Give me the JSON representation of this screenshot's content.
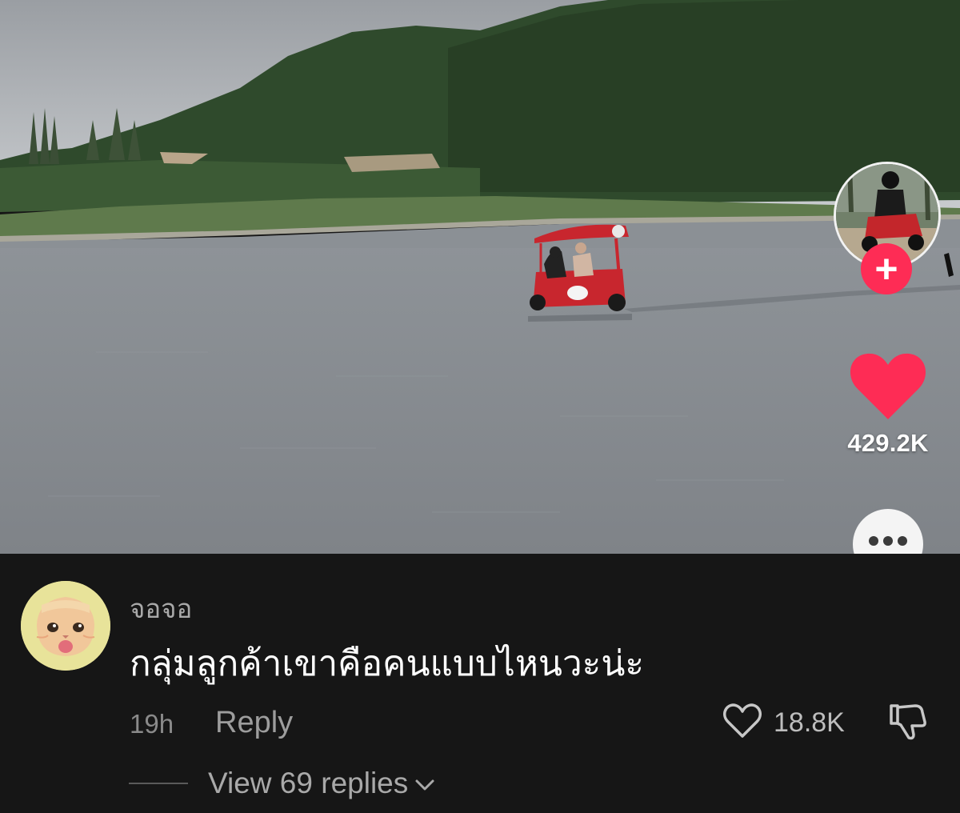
{
  "video": {
    "like_count": "429.2K",
    "follow_icon": "plus-icon",
    "like_icon": "heart-filled-icon",
    "more_icon": "ellipsis-icon",
    "accent_color": "#fe2c55"
  },
  "comment": {
    "username": "จอจอ",
    "text": "กลุ่มลูกค้าเขาคือคนแบบไหนวะน่ะ",
    "time": "19h",
    "reply_label": "Reply",
    "like_count": "18.8K",
    "view_replies_label": "View 69 replies",
    "like_icon": "heart-outline-icon",
    "dislike_icon": "thumbs-down-icon",
    "expand_icon": "chevron-down-icon"
  }
}
